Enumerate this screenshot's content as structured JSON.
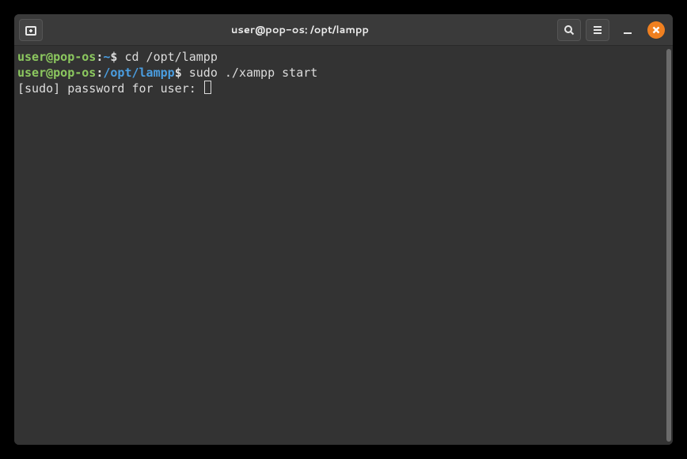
{
  "window": {
    "title": "user@pop-os: /opt/lampp"
  },
  "terminal": {
    "lines": [
      {
        "userhost": "user@pop-os",
        "colon": ":",
        "cwd": "~",
        "prompt": "$ ",
        "command": "cd /opt/lampp"
      },
      {
        "userhost": "user@pop-os",
        "colon": ":",
        "cwd": "/opt/lampp",
        "prompt": "$ ",
        "command": "sudo ./xampp start"
      },
      {
        "text": "[sudo] password for user: "
      }
    ]
  },
  "colors": {
    "userhost": "#8cc85f",
    "cwd": "#4a9de0",
    "window_bg": "#333333",
    "close_button": "#f08020"
  }
}
